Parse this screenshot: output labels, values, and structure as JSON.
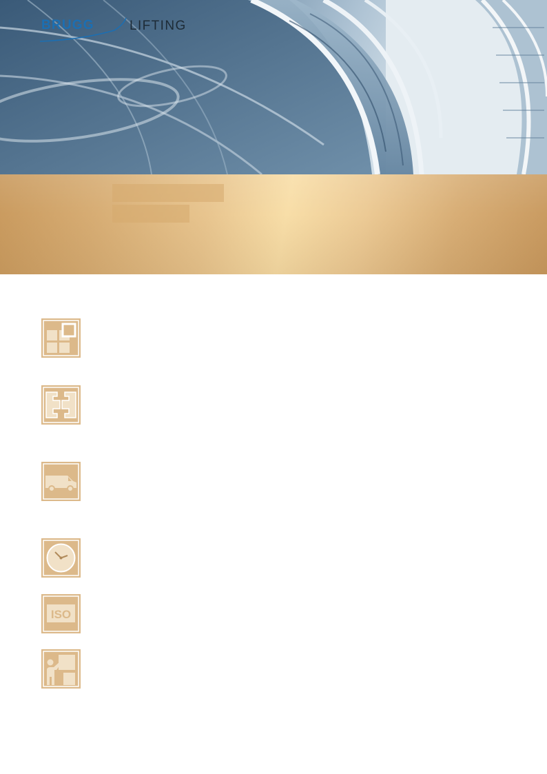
{
  "header": {
    "logo": {
      "brand": "BRUGG",
      "product": "LIFTING",
      "brand_color": "#1b6fb3"
    },
    "background": "glass-architecture-photo"
  },
  "title_band": {
    "color": "#e8c58f"
  },
  "features": [
    {
      "icon": "modular-blocks-icon"
    },
    {
      "icon": "connector-icon"
    },
    {
      "icon": "delivery-van-icon"
    },
    {
      "icon": "clock-icon"
    },
    {
      "icon": "iso-certificate-icon",
      "label": "ISO"
    },
    {
      "icon": "presenter-training-icon"
    }
  ]
}
